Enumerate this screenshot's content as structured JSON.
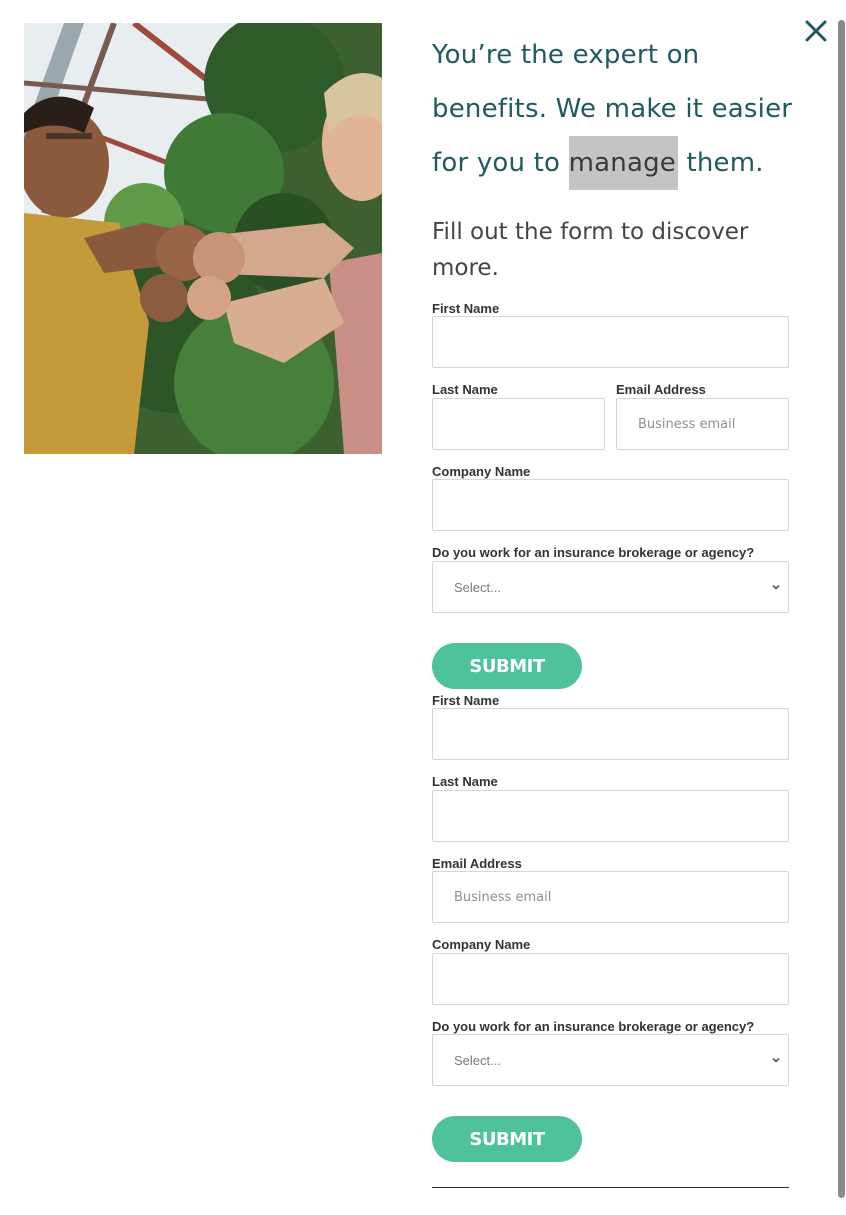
{
  "headline": {
    "before": "You’re the expert on benefits. We make it easier for you to ",
    "highlight": "manage",
    "after": " them."
  },
  "intro": "Fill out the form to discover more.",
  "form1": {
    "first_name_label": "First Name",
    "first_name_value": "",
    "last_name_label": "Last Name",
    "last_name_value": "",
    "email_label": "Email Address",
    "email_placeholder": "Business email",
    "company_label": "Company Name",
    "company_value": "",
    "brokerage_label": "Do you work for an insurance brokerage or agency?",
    "brokerage_selected": "Select...",
    "submit_label": "SUBMIT"
  },
  "form2": {
    "first_name_label": "First Name",
    "first_name_value": "",
    "last_name_label": "Last Name",
    "last_name_value": "",
    "email_label": "Email Address",
    "email_placeholder": "Business email",
    "company_label": "Company Name",
    "company_value": "",
    "brokerage_label": "Do you work for an insurance brokerage or agency?",
    "brokerage_selected": "Select...",
    "submit_label": "SUBMIT"
  },
  "icons": {
    "close": "close-icon",
    "chevron": "chevron-down-icon"
  },
  "colors": {
    "headline": "#1f5a5e",
    "accent": "#4dc29b",
    "close": "#1f5a5e"
  }
}
